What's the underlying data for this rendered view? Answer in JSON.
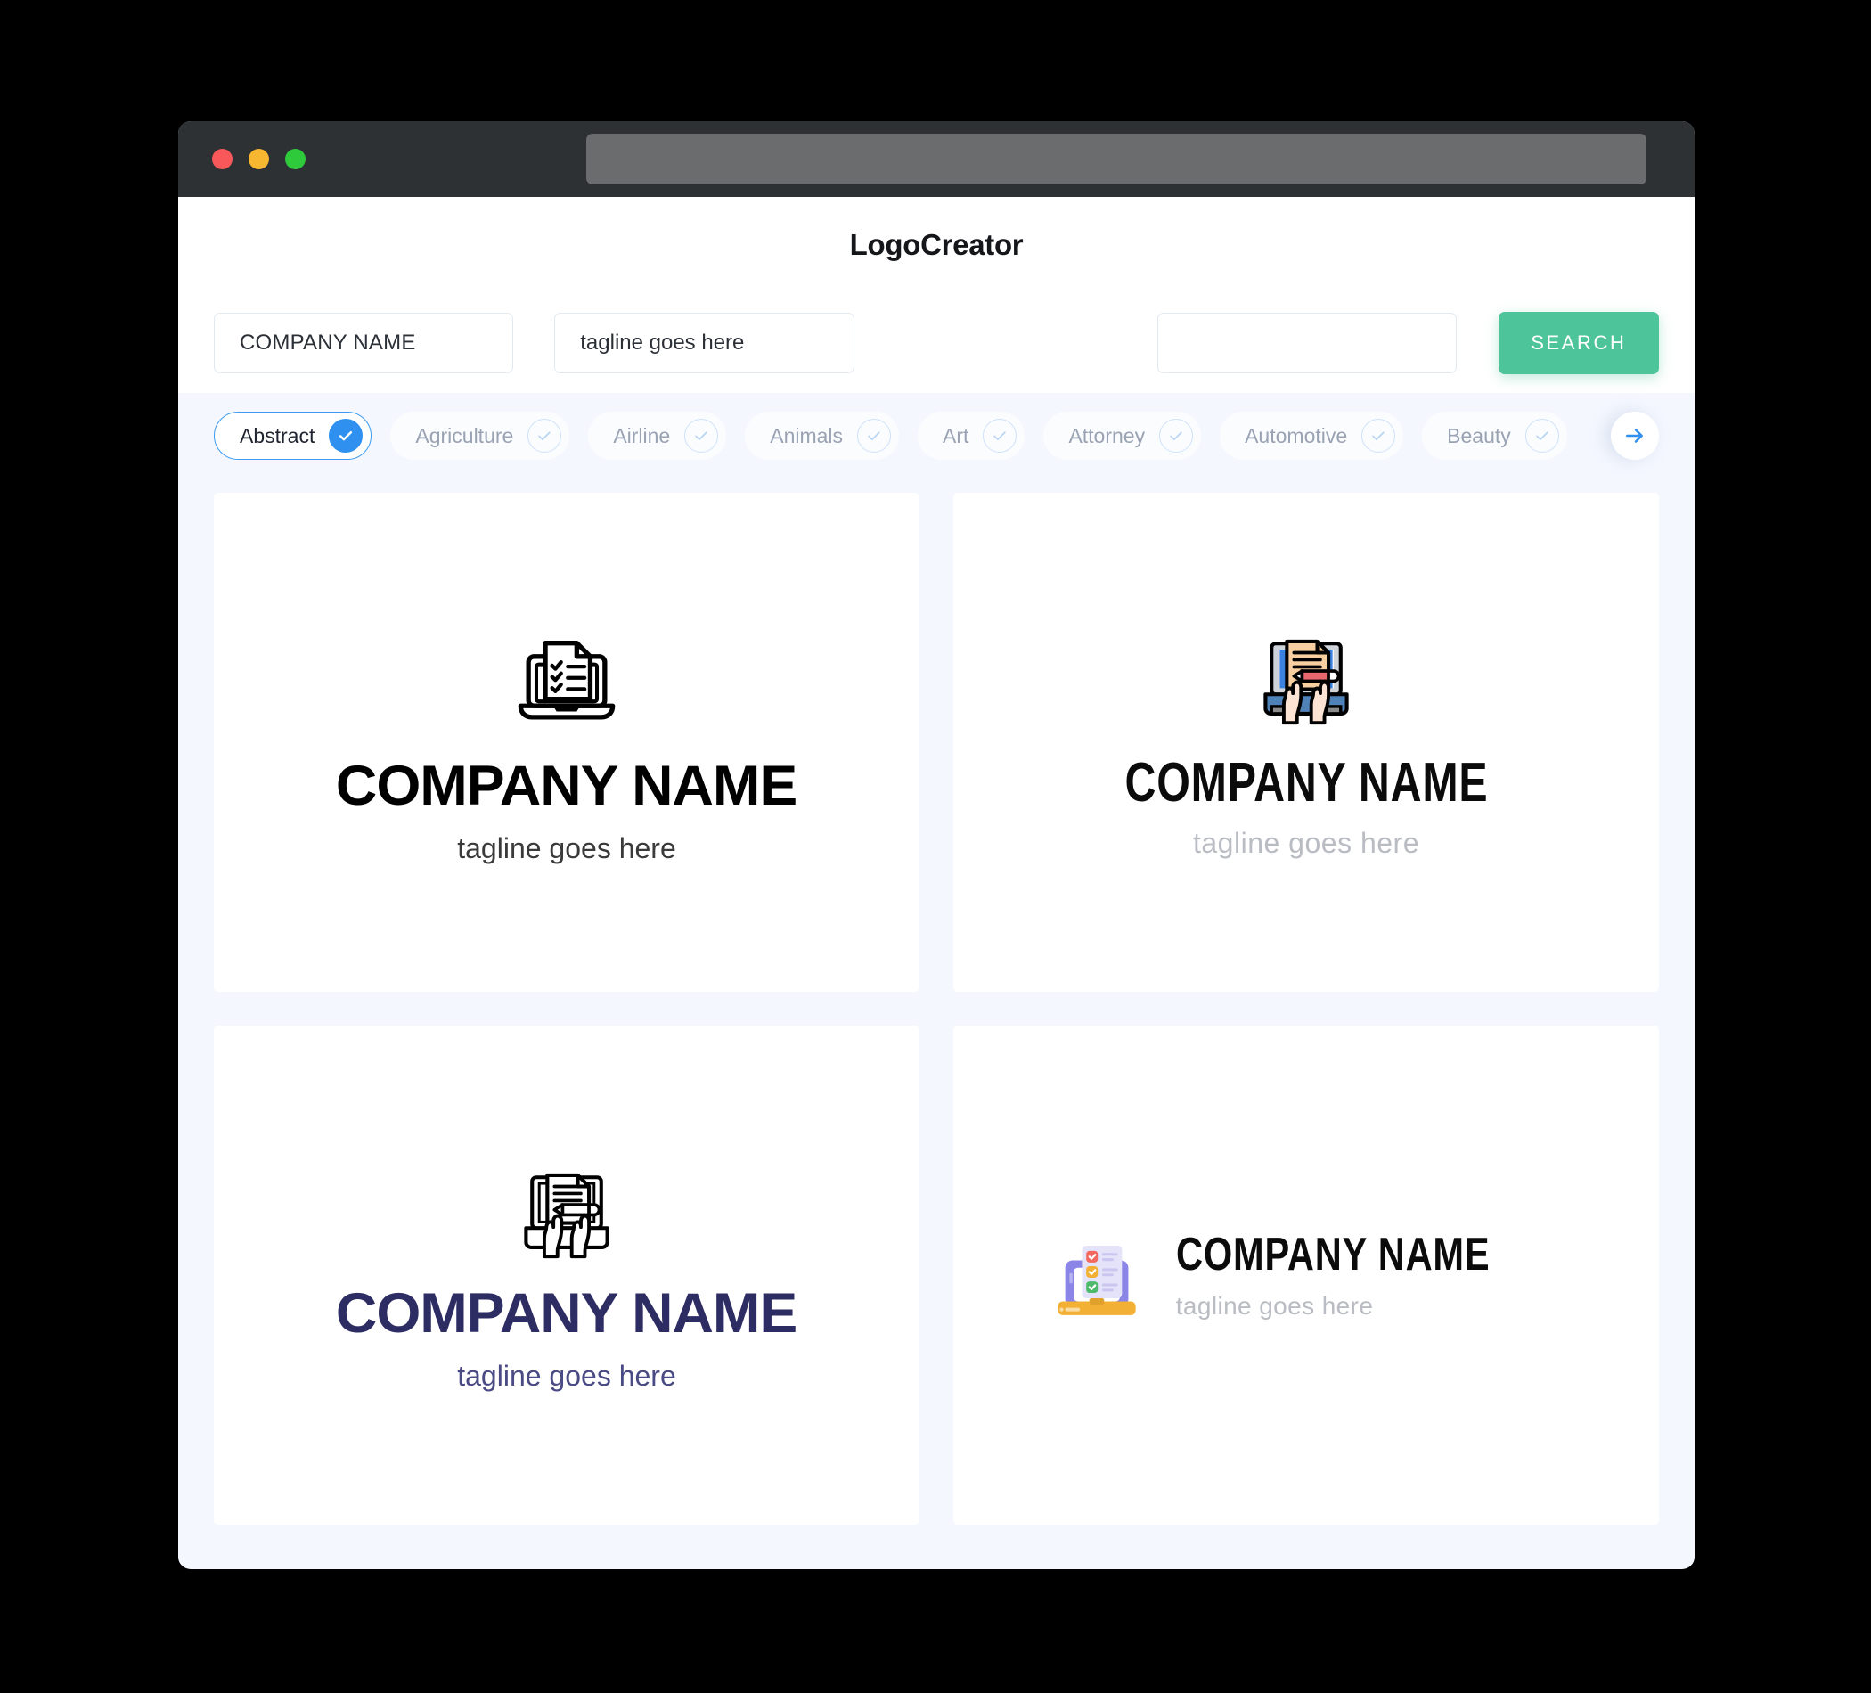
{
  "window": {
    "traffic_lights": [
      "close",
      "minimize",
      "maximize"
    ],
    "url_value": ""
  },
  "header": {
    "brand": "LogoCreator"
  },
  "search": {
    "company_value": "COMPANY NAME",
    "company_placeholder": "COMPANY NAME",
    "tagline_value": "tagline goes here",
    "tagline_placeholder": "tagline goes here",
    "extra_value": "",
    "extra_placeholder": "",
    "button_label": "SEARCH",
    "button_color": "#4ec49a"
  },
  "filters": {
    "active_color": "#2f90f0",
    "next_label": "next-categories",
    "chips": [
      {
        "label": "Abstract",
        "selected": true
      },
      {
        "label": "Agriculture",
        "selected": false
      },
      {
        "label": "Airline",
        "selected": false
      },
      {
        "label": "Animals",
        "selected": false
      },
      {
        "label": "Art",
        "selected": false
      },
      {
        "label": "Attorney",
        "selected": false
      },
      {
        "label": "Automotive",
        "selected": false
      },
      {
        "label": "Beauty",
        "selected": false
      }
    ]
  },
  "results": {
    "cards": [
      {
        "id": "logo-card-1",
        "icon": "laptop-checklist-outline-icon",
        "layout": "vertical",
        "name": "COMPANY NAME",
        "tagline": "tagline goes here",
        "name_color": "#000000",
        "tagline_color": "#3a3a3a"
      },
      {
        "id": "logo-card-2",
        "icon": "laptop-hands-document-pencil-color-icon",
        "layout": "vertical",
        "name": "COMPANY NAME",
        "tagline": "tagline goes here",
        "name_color": "#0b0b0b",
        "tagline_color": "#b9bcc2"
      },
      {
        "id": "logo-card-3",
        "icon": "laptop-hands-document-pencil-outline-icon",
        "layout": "vertical",
        "name": "COMPANY NAME",
        "tagline": "tagline goes here",
        "name_color": "#2d2c63",
        "tagline_color": "#4a4a85"
      },
      {
        "id": "logo-card-4",
        "icon": "laptop-checklist-color-icon",
        "layout": "horizontal",
        "name": "COMPANY NAME",
        "tagline": "tagline goes here",
        "name_color": "#0b0b0b",
        "tagline_color": "#b9bcc2"
      }
    ]
  }
}
